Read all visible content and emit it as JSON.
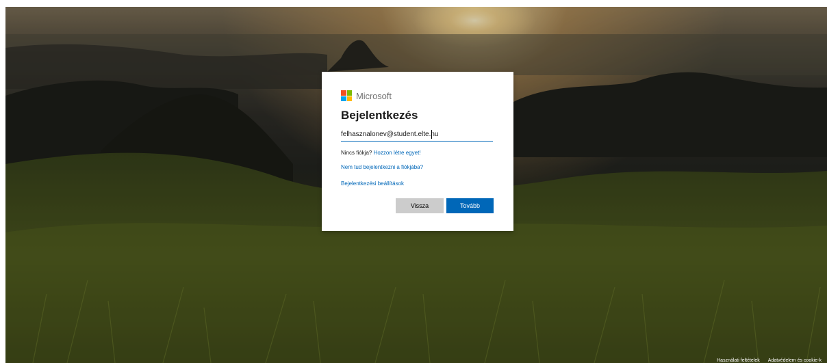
{
  "brand": {
    "name": "Microsoft",
    "logo_colors": [
      "#f25022",
      "#7fba00",
      "#00a4ef",
      "#ffb900"
    ]
  },
  "signin": {
    "title": "Bejelentkezés",
    "email_value": "felhasznalonev@student.elte.hu",
    "no_account_text": "Nincs fiókja?",
    "create_account_link": "Hozzon létre egyet!",
    "cant_access_link": "Nem tud bejelentkezni a fiókjába?",
    "signin_options_link": "Bejelentkezési beállítások",
    "back_button": "Vissza",
    "next_button": "Tovább"
  },
  "footer": {
    "terms_link": "Használati feltételek",
    "privacy_link": "Adatvédelem és cookie-k"
  },
  "colors": {
    "accent": "#0067b8",
    "back_button_bg": "#cccccc"
  }
}
